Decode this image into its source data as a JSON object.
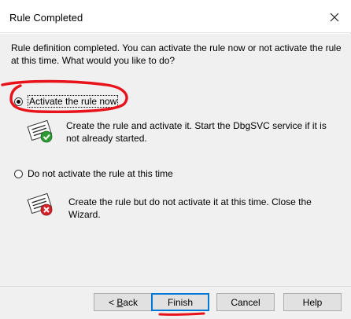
{
  "window": {
    "title": "Rule Completed",
    "close_icon": "close-icon"
  },
  "intro_text": "Rule definition completed. You can activate the rule now or not activate the rule at this time. What would you like to do?",
  "options": [
    {
      "label": "Activate the rule now",
      "selected": true,
      "icon": "rule-activate-icon",
      "description": "Create the rule and activate it. Start the DbgSVC service if it is not already started."
    },
    {
      "label": "Do not activate the rule at this time",
      "selected": false,
      "icon": "rule-no-activate-icon",
      "description": "Create the rule but do not activate it at this time. Close the Wizard."
    }
  ],
  "buttons": {
    "back_prefix": "< ",
    "back_hotkey": "B",
    "back_rest": "ack",
    "finish": "Finish",
    "cancel": "Cancel",
    "help": "Help"
  },
  "colors": {
    "dialog_bg": "#f0f0f0",
    "titlebar_bg": "#ffffff",
    "annotation_red": "#e8131a",
    "check_green": "#2e9a36",
    "cross_red": "#d3232a",
    "default_button_border": "#0078d7"
  }
}
